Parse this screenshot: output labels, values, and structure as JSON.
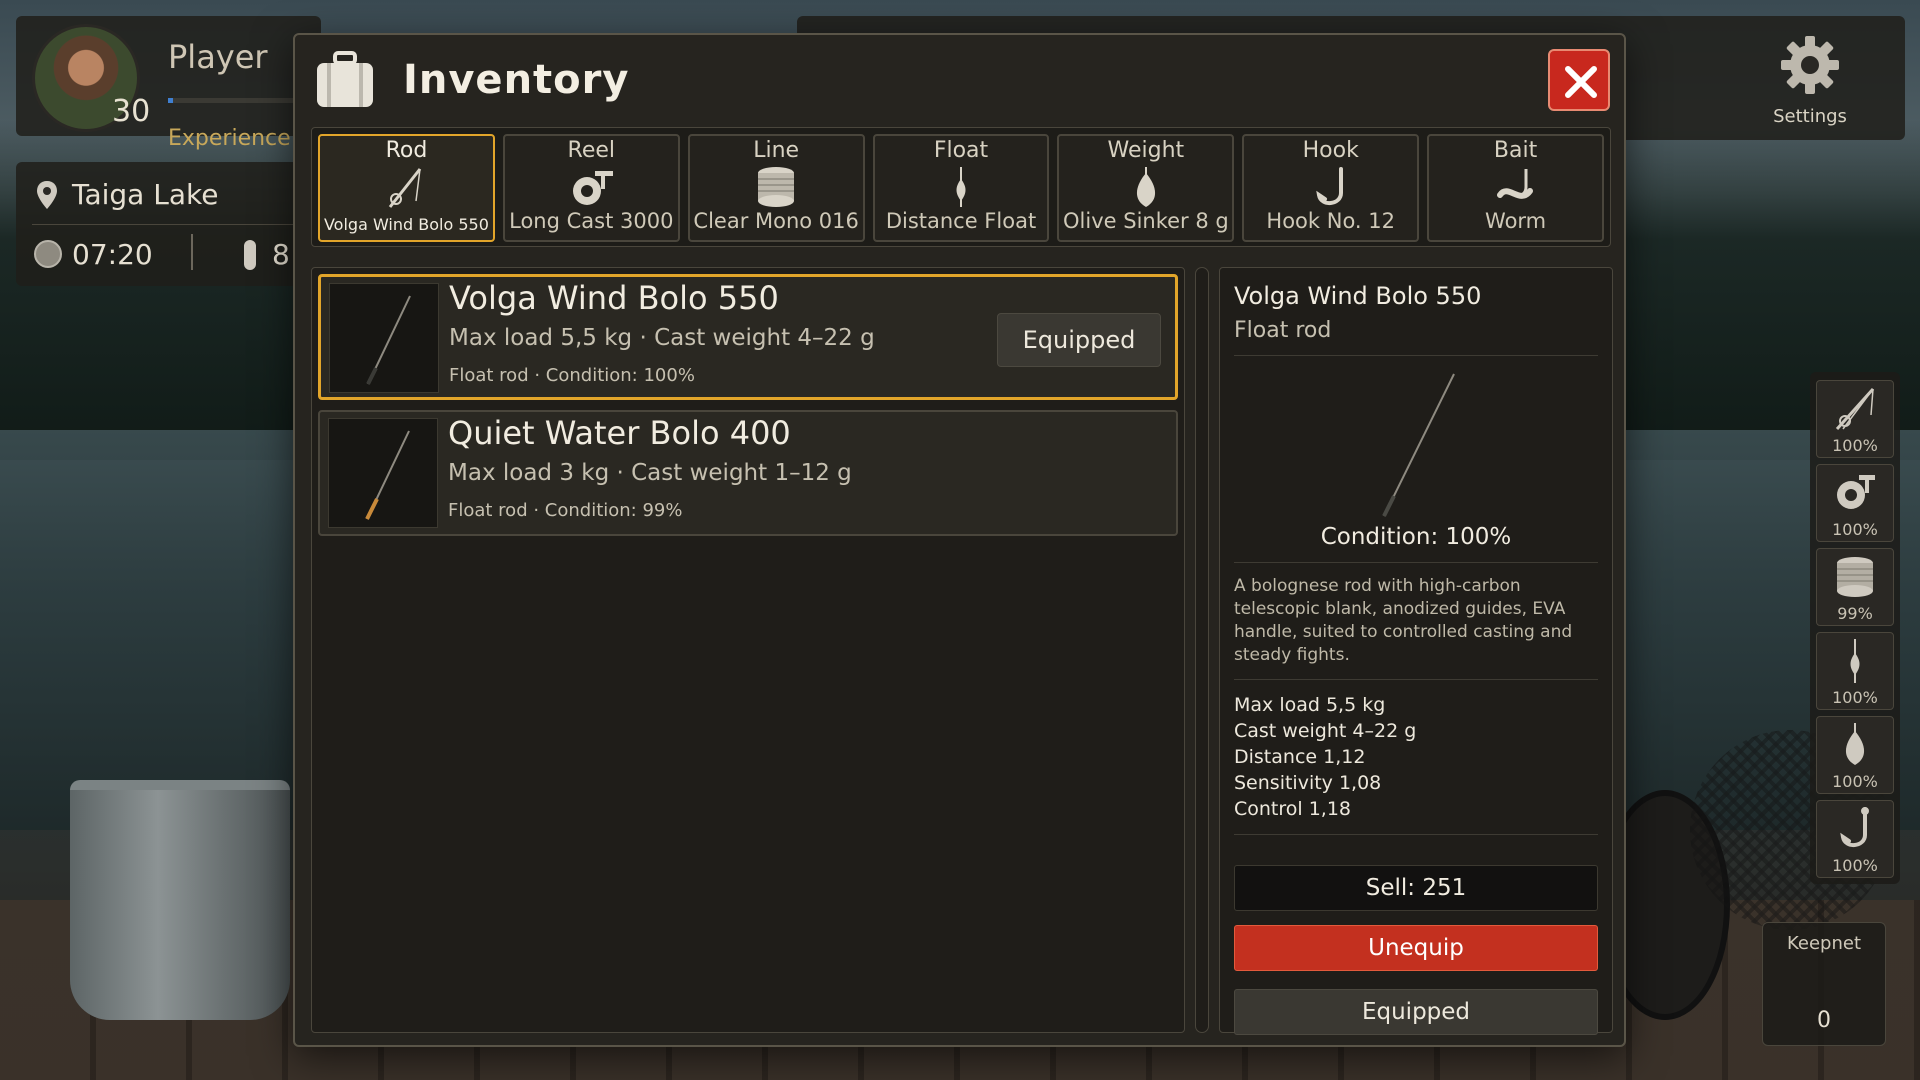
{
  "hud": {
    "player_name": "Player",
    "level": "30",
    "xp_label": "Experience: ",
    "xp_progress": 0.03,
    "location": "Taiga Lake",
    "time": "07:20",
    "temperature": "8"
  },
  "settings": {
    "label": "Settings",
    "icon": "gear-icon"
  },
  "modal": {
    "title": "Inventory",
    "icon": "bag-icon",
    "accent_color": "#e2a52a",
    "close_color": "#c8281e"
  },
  "tabs": [
    {
      "category": "Rod",
      "item": "Volga Wind Bolo 550",
      "icon": "rod-icon",
      "active": true
    },
    {
      "category": "Reel",
      "item": "Long Cast 3000",
      "icon": "reel-icon",
      "active": false
    },
    {
      "category": "Line",
      "item": "Clear Mono 016",
      "icon": "line-spool-icon",
      "active": false
    },
    {
      "category": "Float",
      "item": "Distance Float",
      "icon": "float-icon",
      "active": false
    },
    {
      "category": "Weight",
      "item": "Olive Sinker 8 g",
      "icon": "sinker-icon",
      "active": false
    },
    {
      "category": "Hook",
      "item": "Hook No. 12",
      "icon": "hook-icon",
      "active": false
    },
    {
      "category": "Bait",
      "item": "Worm",
      "icon": "worm-icon",
      "active": false
    }
  ],
  "items": [
    {
      "name": "Volga Wind Bolo 550",
      "stats": "Max load 5,5 kg · Cast weight 4–22 g",
      "sub": "Float rod · Condition: 100%",
      "badge": "Equipped",
      "selected": true
    },
    {
      "name": "Quiet Water Bolo 400",
      "stats": "Max load 3 kg · Cast weight 1–12 g",
      "sub": "Float rod · Condition: 99%",
      "badge": "",
      "selected": false
    }
  ],
  "detail": {
    "name": "Volga Wind Bolo 550",
    "type": "Float rod",
    "condition": "Condition: 100%",
    "description": "A bolognese rod with high-carbon telescopic blank, anodized guides, EVA handle, suited to controlled casting and steady fights.",
    "specs": [
      "Max load 5,5 kg",
      "Cast weight 4–22 g",
      "Distance 1,12",
      "Sensitivity 1,08",
      "Control 1,18"
    ],
    "sell": "Sell: 251",
    "unequip": "Unequip",
    "equipped": "Equipped"
  },
  "quickbar": [
    {
      "icon": "rod-icon",
      "pct": "100%"
    },
    {
      "icon": "reel-icon",
      "pct": "100%"
    },
    {
      "icon": "line-spool-icon",
      "pct": "99%"
    },
    {
      "icon": "float-icon",
      "pct": "100%"
    },
    {
      "icon": "sinker-icon",
      "pct": "100%"
    },
    {
      "icon": "hook-icon",
      "pct": "100%"
    }
  ],
  "keepnet": {
    "label": "Keepnet",
    "count": "0"
  }
}
